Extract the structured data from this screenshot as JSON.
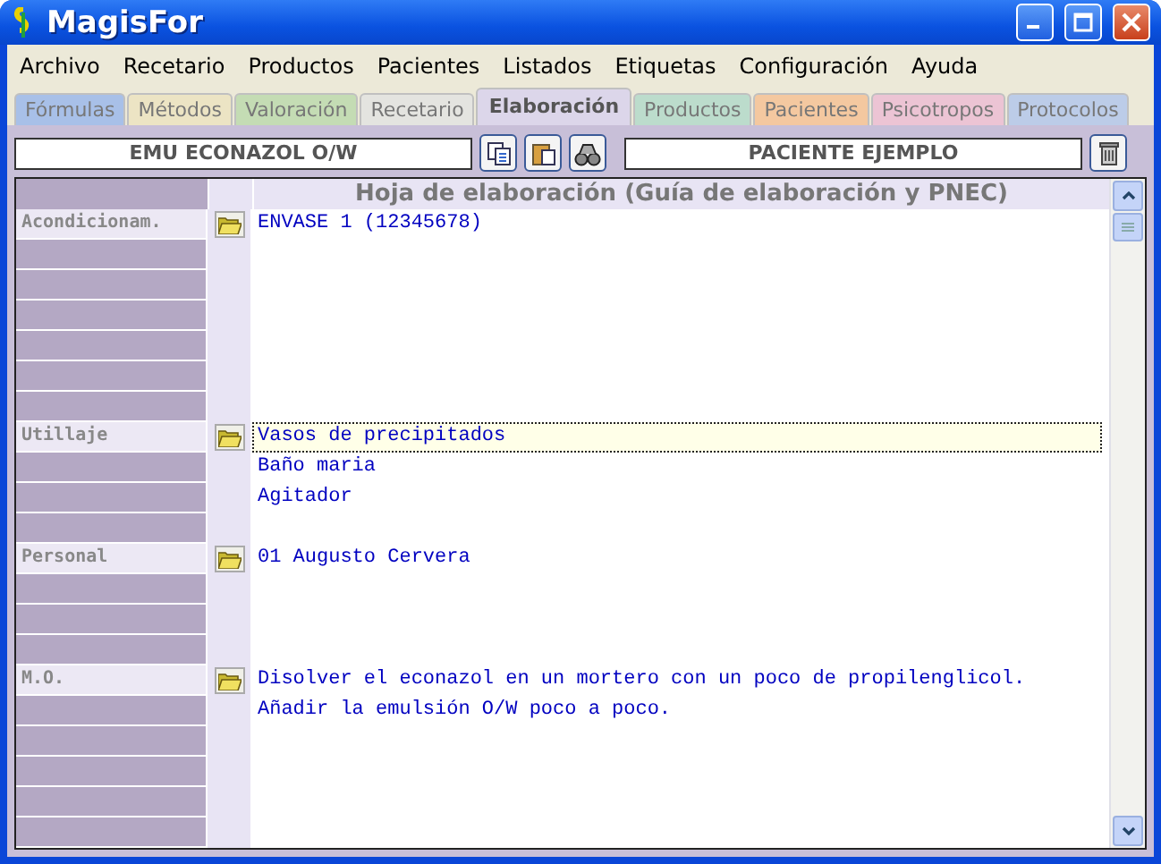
{
  "window": {
    "title": "MagisFor"
  },
  "menu": [
    "Archivo",
    "Recetario",
    "Productos",
    "Pacientes",
    "Listados",
    "Etiquetas",
    "Configuración",
    "Ayuda"
  ],
  "tabs": [
    {
      "label": "Fórmulas",
      "selected": false,
      "color": "#a8c0e8"
    },
    {
      "label": "Métodos",
      "selected": false,
      "color": "#ece4c4"
    },
    {
      "label": "Valoración",
      "selected": false,
      "color": "#c4dcb4"
    },
    {
      "label": "Recetario",
      "selected": false,
      "color": "#e4e4e0"
    },
    {
      "label": "Elaboración",
      "selected": true,
      "color": "#dcd6ea"
    },
    {
      "label": "Productos",
      "selected": false,
      "color": "#bcdccc"
    },
    {
      "label": "Pacientes",
      "selected": false,
      "color": "#f4c8a0"
    },
    {
      "label": "Psicotropos",
      "selected": false,
      "color": "#ecc4d4"
    },
    {
      "label": "Protocolos",
      "selected": false,
      "color": "#bccce8"
    }
  ],
  "toolbar": {
    "formula": "EMU ECONAZOL O/W",
    "patient": "PACIENTE EJEMPLO"
  },
  "sheet": {
    "title": "Hoja de elaboración (Guía de elaboración y PNEC)",
    "sections": [
      {
        "label": "Acondicionam.",
        "lines": [
          {
            "text": "ENVASE 1 (12345678)",
            "selected": false
          }
        ]
      },
      {
        "label": "Utillaje",
        "lines": [
          {
            "text": "Vasos de precipitados",
            "selected": true
          },
          {
            "text": "Baño maria",
            "selected": false
          },
          {
            "text": "Agitador",
            "selected": false
          }
        ]
      },
      {
        "label": "Personal",
        "lines": [
          {
            "text": "01 Augusto Cervera",
            "selected": false
          }
        ]
      },
      {
        "label": "M.O.",
        "lines": [
          {
            "text": "Disolver el econazol en un mortero con un poco de propilenglicol.",
            "selected": false
          },
          {
            "text": "Añadir la emulsión O/W poco a poco.",
            "selected": false
          }
        ]
      }
    ]
  }
}
